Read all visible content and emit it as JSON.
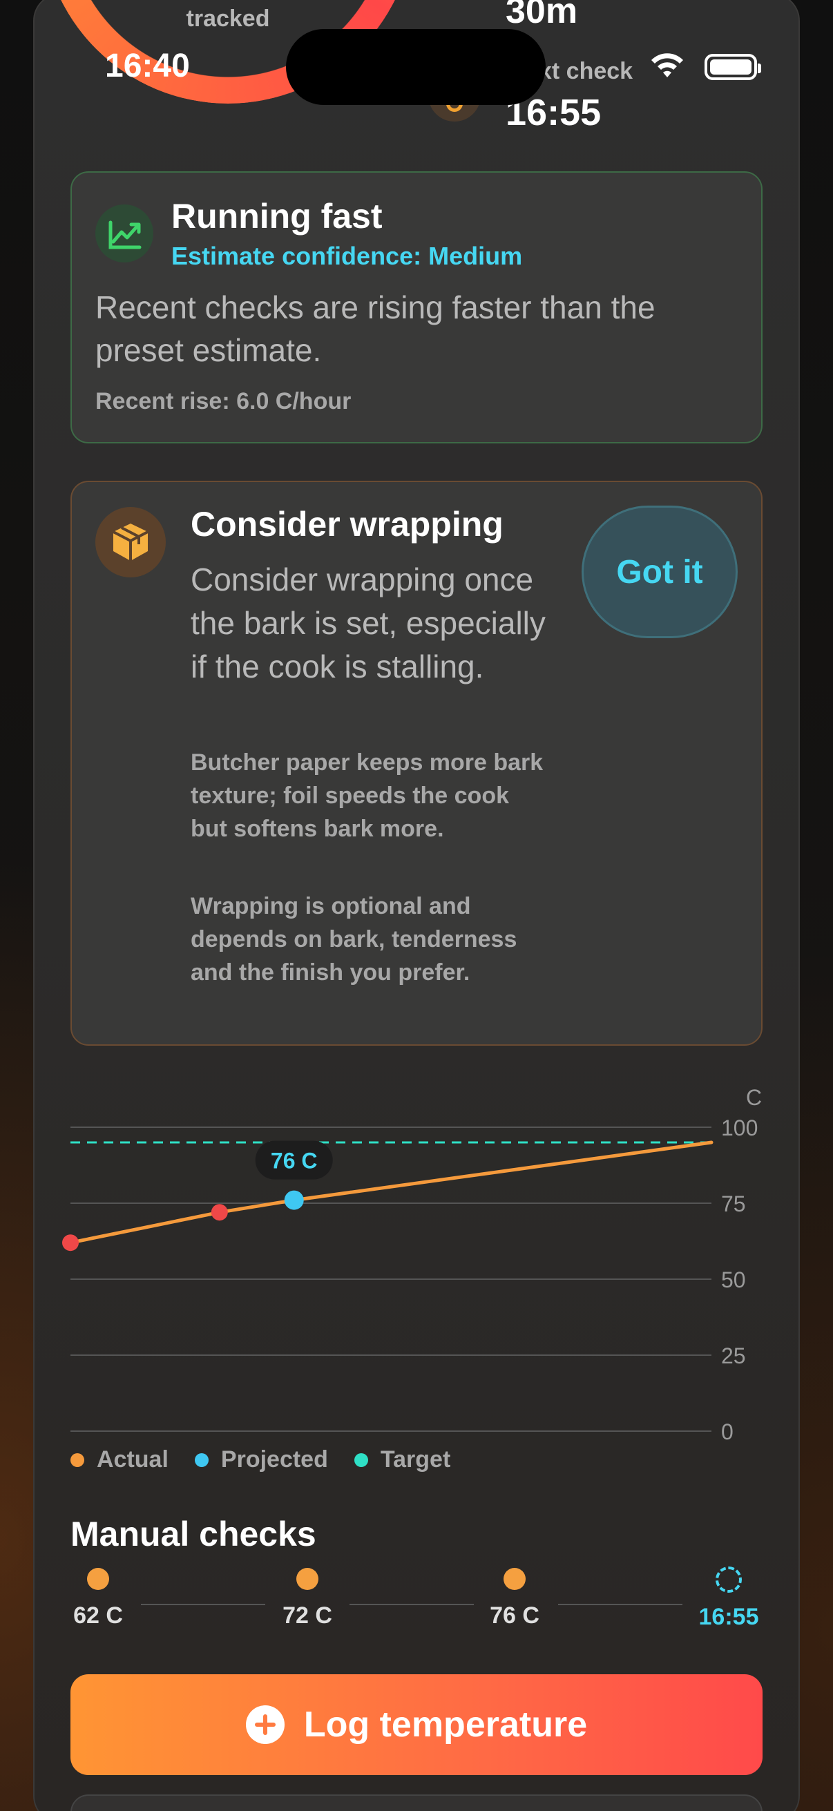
{
  "header": {
    "tracked_label": "tracked",
    "remaining_value": "30m",
    "next_check_label": "xt check",
    "next_check_time": "16:55"
  },
  "status_bar": {
    "time": "16:40"
  },
  "status_card": {
    "title": "Running fast",
    "confidence": "Estimate confidence: Medium",
    "body": "Recent checks are rising faster than the preset estimate.",
    "recent_rise": "Recent rise: 6.0 C/hour",
    "accent_color": "#3fd46a",
    "icon": "trend-up-icon"
  },
  "advice_card": {
    "title": "Consider wrapping",
    "body": "Consider wrapping once the bark is set, especially if the cook is stalling.",
    "note1": "Butcher paper keeps more bark texture; foil speeds the cook but softens bark more.",
    "note2": "Wrapping is optional and depends on bark, tenderness and the finish you prefer.",
    "button_label": "Got it",
    "icon": "package-icon"
  },
  "chart_data": {
    "type": "line",
    "ylabel": "C",
    "ylim": [
      0,
      100
    ],
    "yticks": [
      "100",
      "75",
      "50",
      "25",
      "0"
    ],
    "target_line": 95,
    "series": [
      {
        "name": "Actual",
        "points": [
          [
            0,
            62
          ],
          [
            1,
            72
          ],
          [
            1.5,
            76
          ]
        ],
        "color": "#f59a3c"
      },
      {
        "name": "Projected",
        "points": [
          [
            1.5,
            76
          ],
          [
            4.3,
            95
          ]
        ],
        "color": "#f59a3c"
      }
    ],
    "highlight": {
      "x": 1.5,
      "y": 76,
      "label": "76 C"
    },
    "legend": [
      {
        "label": "Actual",
        "color": "#f59a3c"
      },
      {
        "label": "Projected",
        "color": "#3fc8f2"
      },
      {
        "label": "Target",
        "color": "#2fe0c6"
      }
    ]
  },
  "manual_checks": {
    "title": "Manual checks",
    "items": [
      "62 C",
      "72 C",
      "76 C"
    ],
    "next": "16:55"
  },
  "log_button": {
    "label": "Log temperature"
  }
}
